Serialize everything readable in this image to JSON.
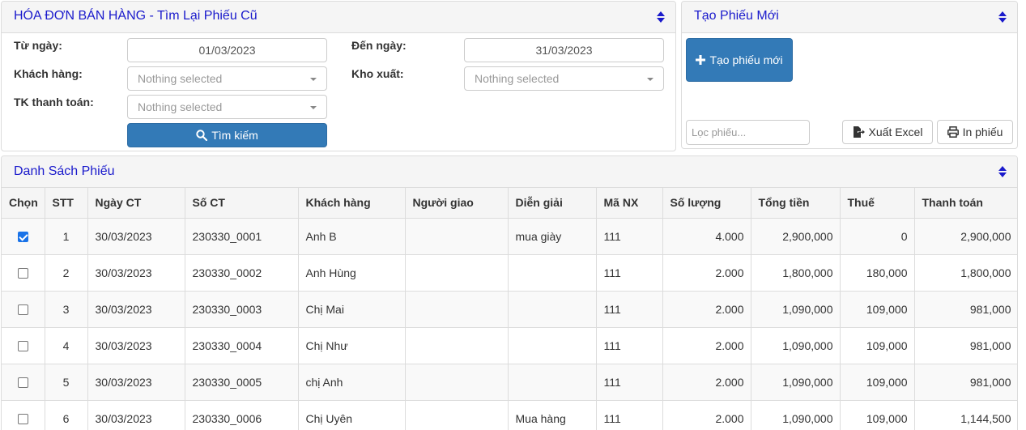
{
  "search_panel": {
    "title": "HÓA ĐƠN BÁN HÀNG - Tìm Lại Phiếu Cũ",
    "from_date_label": "Từ ngày:",
    "from_date_value": "01/03/2023",
    "to_date_label": "Đến ngày:",
    "to_date_value": "31/03/2023",
    "customer_label": "Khách hàng:",
    "customer_value": "Nothing selected",
    "warehouse_label": "Kho xuất:",
    "warehouse_value": "Nothing selected",
    "payment_label": "TK thanh toán:",
    "payment_value": "Nothing selected",
    "search_button": "Tìm kiếm"
  },
  "new_panel": {
    "title": "Tạo Phiếu Mới",
    "create_button": "Tạo phiếu mới",
    "filter_placeholder": "Lọc phiếu...",
    "export_button": "Xuất Excel",
    "print_button": "In phiếu"
  },
  "list_panel": {
    "title": "Danh Sách Phiếu",
    "columns": [
      "Chọn",
      "STT",
      "Ngày CT",
      "Số CT",
      "Khách hàng",
      "Người giao",
      "Diễn giải",
      "Mã NX",
      "Số lượng",
      "Tổng tiền",
      "Thuế",
      "Thanh toán"
    ],
    "rows": [
      {
        "checked": true,
        "stt": "1",
        "date": "30/03/2023",
        "code": "230330_0001",
        "customer": "Anh B",
        "deliverer": "",
        "desc": "mua giày",
        "mnx": "111",
        "qty": "4.000",
        "total": "2,900,000",
        "tax": "0",
        "pay": "2,900,000"
      },
      {
        "checked": false,
        "stt": "2",
        "date": "30/03/2023",
        "code": "230330_0002",
        "customer": "Anh Hùng",
        "deliverer": "",
        "desc": "",
        "mnx": "111",
        "qty": "2.000",
        "total": "1,800,000",
        "tax": "180,000",
        "pay": "1,800,000"
      },
      {
        "checked": false,
        "stt": "3",
        "date": "30/03/2023",
        "code": "230330_0003",
        "customer": "Chị Mai",
        "deliverer": "",
        "desc": "",
        "mnx": "111",
        "qty": "2.000",
        "total": "1,090,000",
        "tax": "109,000",
        "pay": "981,000"
      },
      {
        "checked": false,
        "stt": "4",
        "date": "30/03/2023",
        "code": "230330_0004",
        "customer": "Chị Như",
        "deliverer": "",
        "desc": "",
        "mnx": "111",
        "qty": "2.000",
        "total": "1,090,000",
        "tax": "109,000",
        "pay": "981,000"
      },
      {
        "checked": false,
        "stt": "5",
        "date": "30/03/2023",
        "code": "230330_0005",
        "customer": "chị Anh",
        "deliverer": "",
        "desc": "",
        "mnx": "111",
        "qty": "2.000",
        "total": "1,090,000",
        "tax": "109,000",
        "pay": "981,000"
      },
      {
        "checked": false,
        "stt": "6",
        "date": "30/03/2023",
        "code": "230330_0006",
        "customer": "Chị Uyên",
        "deliverer": "",
        "desc": "Mua hàng",
        "mnx": "111",
        "qty": "2.000",
        "total": "1,090,000",
        "tax": "109,000",
        "pay": "1,144,500"
      }
    ]
  },
  "colors": {
    "title_blue": "#1a1acc",
    "primary": "#337ab7"
  },
  "icons": [
    "sort-icon",
    "search-icon",
    "plus-icon",
    "export-file-icon",
    "print-icon",
    "caret-down-icon"
  ]
}
